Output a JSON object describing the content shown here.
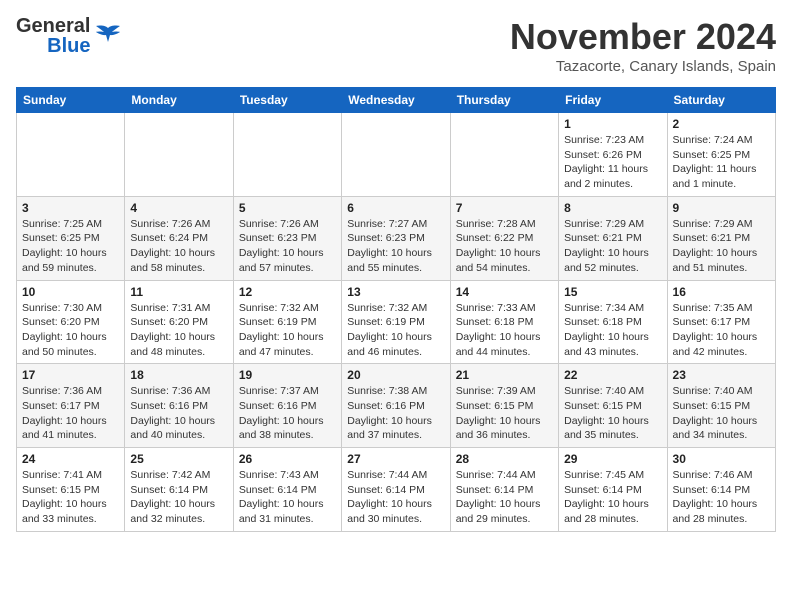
{
  "header": {
    "logo_general": "General",
    "logo_blue": "Blue",
    "title": "November 2024",
    "location": "Tazacorte, Canary Islands, Spain"
  },
  "weekdays": [
    "Sunday",
    "Monday",
    "Tuesday",
    "Wednesday",
    "Thursday",
    "Friday",
    "Saturday"
  ],
  "weeks": [
    [
      {
        "day": "",
        "info": ""
      },
      {
        "day": "",
        "info": ""
      },
      {
        "day": "",
        "info": ""
      },
      {
        "day": "",
        "info": ""
      },
      {
        "day": "",
        "info": ""
      },
      {
        "day": "1",
        "info": "Sunrise: 7:23 AM\nSunset: 6:26 PM\nDaylight: 11 hours and 2 minutes."
      },
      {
        "day": "2",
        "info": "Sunrise: 7:24 AM\nSunset: 6:25 PM\nDaylight: 11 hours and 1 minute."
      }
    ],
    [
      {
        "day": "3",
        "info": "Sunrise: 7:25 AM\nSunset: 6:25 PM\nDaylight: 10 hours and 59 minutes."
      },
      {
        "day": "4",
        "info": "Sunrise: 7:26 AM\nSunset: 6:24 PM\nDaylight: 10 hours and 58 minutes."
      },
      {
        "day": "5",
        "info": "Sunrise: 7:26 AM\nSunset: 6:23 PM\nDaylight: 10 hours and 57 minutes."
      },
      {
        "day": "6",
        "info": "Sunrise: 7:27 AM\nSunset: 6:23 PM\nDaylight: 10 hours and 55 minutes."
      },
      {
        "day": "7",
        "info": "Sunrise: 7:28 AM\nSunset: 6:22 PM\nDaylight: 10 hours and 54 minutes."
      },
      {
        "day": "8",
        "info": "Sunrise: 7:29 AM\nSunset: 6:21 PM\nDaylight: 10 hours and 52 minutes."
      },
      {
        "day": "9",
        "info": "Sunrise: 7:29 AM\nSunset: 6:21 PM\nDaylight: 10 hours and 51 minutes."
      }
    ],
    [
      {
        "day": "10",
        "info": "Sunrise: 7:30 AM\nSunset: 6:20 PM\nDaylight: 10 hours and 50 minutes."
      },
      {
        "day": "11",
        "info": "Sunrise: 7:31 AM\nSunset: 6:20 PM\nDaylight: 10 hours and 48 minutes."
      },
      {
        "day": "12",
        "info": "Sunrise: 7:32 AM\nSunset: 6:19 PM\nDaylight: 10 hours and 47 minutes."
      },
      {
        "day": "13",
        "info": "Sunrise: 7:32 AM\nSunset: 6:19 PM\nDaylight: 10 hours and 46 minutes."
      },
      {
        "day": "14",
        "info": "Sunrise: 7:33 AM\nSunset: 6:18 PM\nDaylight: 10 hours and 44 minutes."
      },
      {
        "day": "15",
        "info": "Sunrise: 7:34 AM\nSunset: 6:18 PM\nDaylight: 10 hours and 43 minutes."
      },
      {
        "day": "16",
        "info": "Sunrise: 7:35 AM\nSunset: 6:17 PM\nDaylight: 10 hours and 42 minutes."
      }
    ],
    [
      {
        "day": "17",
        "info": "Sunrise: 7:36 AM\nSunset: 6:17 PM\nDaylight: 10 hours and 41 minutes."
      },
      {
        "day": "18",
        "info": "Sunrise: 7:36 AM\nSunset: 6:16 PM\nDaylight: 10 hours and 40 minutes."
      },
      {
        "day": "19",
        "info": "Sunrise: 7:37 AM\nSunset: 6:16 PM\nDaylight: 10 hours and 38 minutes."
      },
      {
        "day": "20",
        "info": "Sunrise: 7:38 AM\nSunset: 6:16 PM\nDaylight: 10 hours and 37 minutes."
      },
      {
        "day": "21",
        "info": "Sunrise: 7:39 AM\nSunset: 6:15 PM\nDaylight: 10 hours and 36 minutes."
      },
      {
        "day": "22",
        "info": "Sunrise: 7:40 AM\nSunset: 6:15 PM\nDaylight: 10 hours and 35 minutes."
      },
      {
        "day": "23",
        "info": "Sunrise: 7:40 AM\nSunset: 6:15 PM\nDaylight: 10 hours and 34 minutes."
      }
    ],
    [
      {
        "day": "24",
        "info": "Sunrise: 7:41 AM\nSunset: 6:15 PM\nDaylight: 10 hours and 33 minutes."
      },
      {
        "day": "25",
        "info": "Sunrise: 7:42 AM\nSunset: 6:14 PM\nDaylight: 10 hours and 32 minutes."
      },
      {
        "day": "26",
        "info": "Sunrise: 7:43 AM\nSunset: 6:14 PM\nDaylight: 10 hours and 31 minutes."
      },
      {
        "day": "27",
        "info": "Sunrise: 7:44 AM\nSunset: 6:14 PM\nDaylight: 10 hours and 30 minutes."
      },
      {
        "day": "28",
        "info": "Sunrise: 7:44 AM\nSunset: 6:14 PM\nDaylight: 10 hours and 29 minutes."
      },
      {
        "day": "29",
        "info": "Sunrise: 7:45 AM\nSunset: 6:14 PM\nDaylight: 10 hours and 28 minutes."
      },
      {
        "day": "30",
        "info": "Sunrise: 7:46 AM\nSunset: 6:14 PM\nDaylight: 10 hours and 28 minutes."
      }
    ]
  ]
}
